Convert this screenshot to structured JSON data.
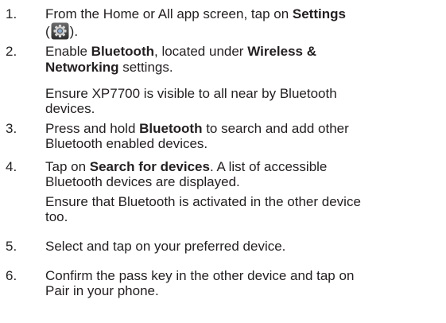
{
  "steps": [
    {
      "number": "1.",
      "lines": [
        {
          "a": "From the Home or All app screen, tap on ",
          "b": "Settings"
        },
        {
          "a": "(",
          "icon": "settings-gear-icon",
          "c": ")."
        }
      ]
    },
    {
      "number": "2.",
      "lines": [
        {
          "a": "Enable ",
          "b": "Bluetooth",
          "c": ", located under ",
          "d": "Wireless &"
        },
        {
          "b": "Networking",
          "c": " settings."
        }
      ],
      "notes": [
        "Ensure XP7700 is visible to all near by Bluetooth",
        "devices."
      ]
    },
    {
      "number": "3.",
      "lines": [
        {
          "a": "Press and hold ",
          "b": "Bluetooth",
          "c": " to search and add other"
        },
        {
          "a": "Bluetooth enabled devices."
        }
      ]
    },
    {
      "number": "4.",
      "lines": [
        {
          "a": "Tap on ",
          "b": "Search for devices",
          "c": ". A list of accessible"
        },
        {
          "a": "Bluetooth devices are displayed."
        }
      ],
      "notes": [
        "Ensure that Bluetooth is activated in the other device",
        "too."
      ]
    },
    {
      "number": "5.",
      "lines": [
        {
          "a": "Select and tap on your preferred device."
        }
      ]
    },
    {
      "number": "6.",
      "lines": [
        {
          "a": "Confirm the pass key in the other device and tap on"
        },
        {
          "a": "Pair in your phone."
        }
      ]
    }
  ]
}
